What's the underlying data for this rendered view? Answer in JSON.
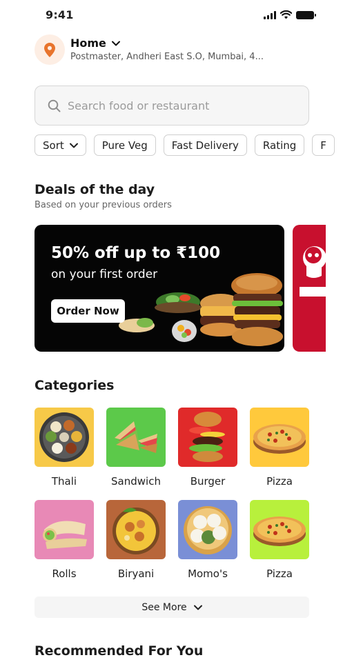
{
  "status_bar": {
    "time": "9:41"
  },
  "location": {
    "title": "Home",
    "address": "Postmaster, Andheri East S.O, Mumbai, 4..."
  },
  "search": {
    "placeholder": "Search food or restaurant"
  },
  "filters": [
    "Sort",
    "Pure Veg",
    "Fast Delivery",
    "Rating",
    "F"
  ],
  "deals": {
    "title": "Deals of the day",
    "subtitle": "Based on your previous orders",
    "banner": {
      "headline": "50% off up to ₹100",
      "subline": "on your first order",
      "cta": "Order Now"
    }
  },
  "categories": {
    "title": "Categories",
    "items": [
      {
        "label": "Thali",
        "bg": "#f7c948"
      },
      {
        "label": "Sandwich",
        "bg": "#5cc94a"
      },
      {
        "label": "Burger",
        "bg": "#e02a2a"
      },
      {
        "label": "Pizza",
        "bg": "#ffc93c"
      },
      {
        "label": "Rolls",
        "bg": "#e889b6"
      },
      {
        "label": "Biryani",
        "bg": "#b8663a"
      },
      {
        "label": "Momo's",
        "bg": "#7a8fd6"
      },
      {
        "label": "Pizza",
        "bg": "#b8f03c"
      }
    ],
    "see_more": "See More"
  },
  "recommended": {
    "title": "Recommended For You"
  },
  "colors": {
    "accent": "#e8742c",
    "kfc_red": "#c8102e"
  }
}
